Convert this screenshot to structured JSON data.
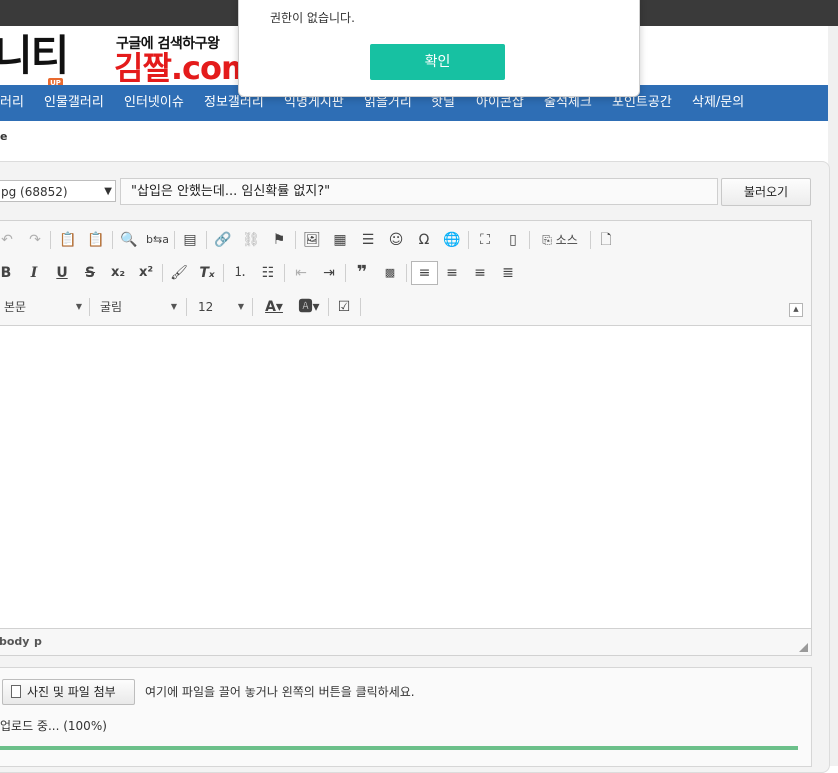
{
  "header": {
    "logo_text": "니티",
    "logo_badge": "UP",
    "banner_top": "구글에 검색하구왕",
    "banner_main": "김짤.com"
  },
  "nav": {
    "items": [
      "러리",
      "인물갤러리",
      "인터넷이슈",
      "정보갤러리",
      "익명게시판",
      "읽을거리",
      "핫딜",
      "아이콘샵",
      "출석체크",
      "포인트공간",
      "삭제/문의"
    ]
  },
  "breadcrumb": "e",
  "editor": {
    "file_select_value": "pg (68852)",
    "title_value": "\"삽입은 안했는데... 임신확률 없지?\"",
    "load_button": "불러오기",
    "source_label": "소스",
    "format_combo": "본문",
    "font_combo": "굴림",
    "size_combo": "12",
    "status_path": [
      "body",
      "p"
    ]
  },
  "upload": {
    "attach_button": "사진 및 파일 첨부",
    "drop_hint": "여기에 파일을 끌어 놓거나 왼쪽의 버튼을 클릭하세요.",
    "progress_text": "업로드 중... (100%)",
    "progress_percent": 100
  },
  "modal": {
    "message": "권한이 없습니다.",
    "confirm_button": "확인"
  },
  "colors": {
    "nav_bg": "#2e6eb5",
    "confirm_bg": "#17c1a2",
    "progress_fill": "#6cc08a",
    "banner_red": "#e41b1b"
  }
}
